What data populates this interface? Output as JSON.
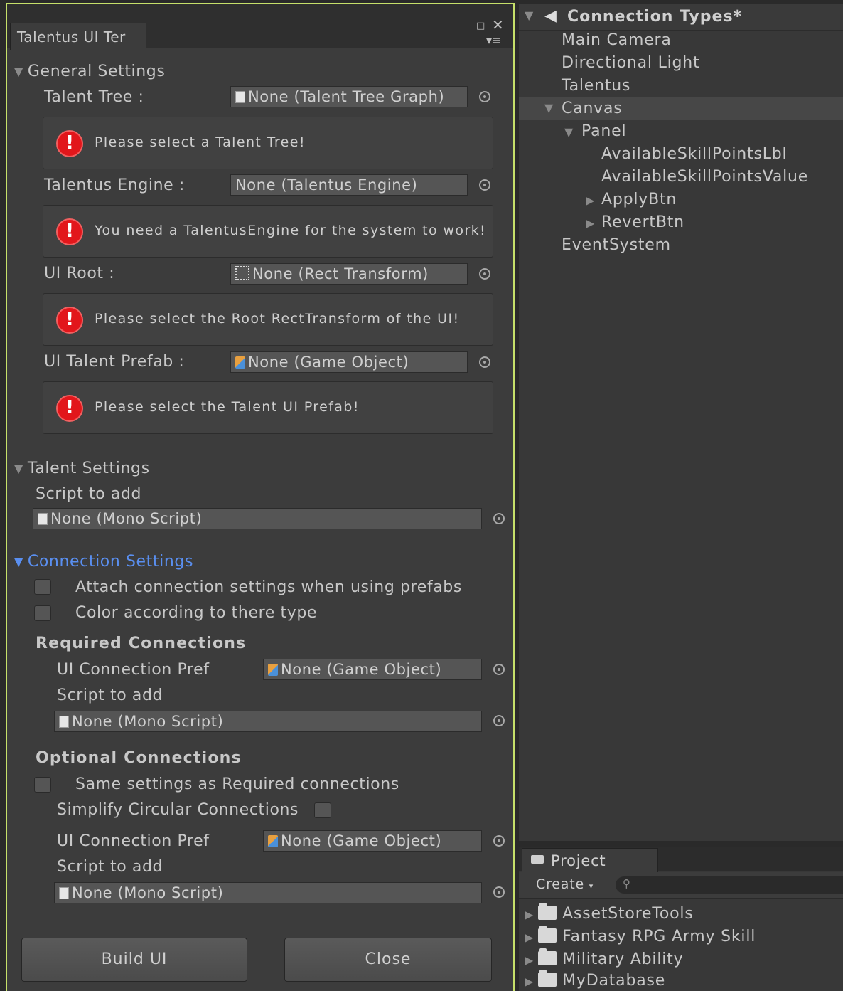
{
  "editor": {
    "tab_title": "Talentus UI Ter",
    "general_settings": {
      "header": "General Settings",
      "talent_tree": {
        "label": "Talent Tree :",
        "value": "None (Talent Tree Graph)",
        "error": "Please select a Talent Tree!"
      },
      "talentus_engine": {
        "label": "Talentus Engine :",
        "value": "None (Talentus Engine)",
        "error": "You need a TalentusEngine for the system to work!"
      },
      "ui_root": {
        "label": "UI Root :",
        "value": "None (Rect Transform)",
        "error": "Please select the Root RectTransform of the UI!"
      },
      "ui_talent_prefab": {
        "label": "UI Talent Prefab :",
        "value": "None (Game Object)",
        "error": "Please select the Talent UI Prefab!"
      }
    },
    "talent_settings": {
      "header": "Talent Settings",
      "script_label": "Script to add",
      "script_value": "None (Mono Script)"
    },
    "connection_settings": {
      "header": "Connection Settings",
      "attach_label": "Attach connection settings when using prefabs",
      "attach_checked": false,
      "color_label": "Color according to there type",
      "color_checked": false,
      "required": {
        "header": "Required Connections",
        "pref_label": "UI Connection Pref",
        "pref_value": "None (Game Object)",
        "script_label": "Script to add",
        "script_value": "None (Mono Script)"
      },
      "optional": {
        "header": "Optional Connections",
        "same_label": "Same settings as Required connections",
        "same_checked": false,
        "simplify_label": "Simplify Circular Connections",
        "simplify_checked": false,
        "pref_label": "UI Connection Pref",
        "pref_value": "None (Game Object)",
        "script_label": "Script to add",
        "script_value": "None (Mono Script)"
      }
    },
    "buttons": {
      "build": "Build UI",
      "close": "Close"
    }
  },
  "hierarchy": {
    "scene": "Connection Types*",
    "items": [
      "Main Camera",
      "Directional Light",
      "Talentus",
      "Canvas",
      "Panel",
      "AvailableSkillPointsLbl",
      "AvailableSkillPointsValue",
      "ApplyBtn",
      "RevertBtn",
      "EventSystem"
    ]
  },
  "project": {
    "tab": "Project",
    "create": "Create",
    "folders": [
      "AssetStoreTools",
      "Fantasy RPG Army Skill",
      "Military Ability",
      "MyDatabase"
    ]
  },
  "colors": {
    "accent_blue": "#5a8ff0",
    "window_border": "#c6e06a",
    "error_red": "#e2161b"
  }
}
